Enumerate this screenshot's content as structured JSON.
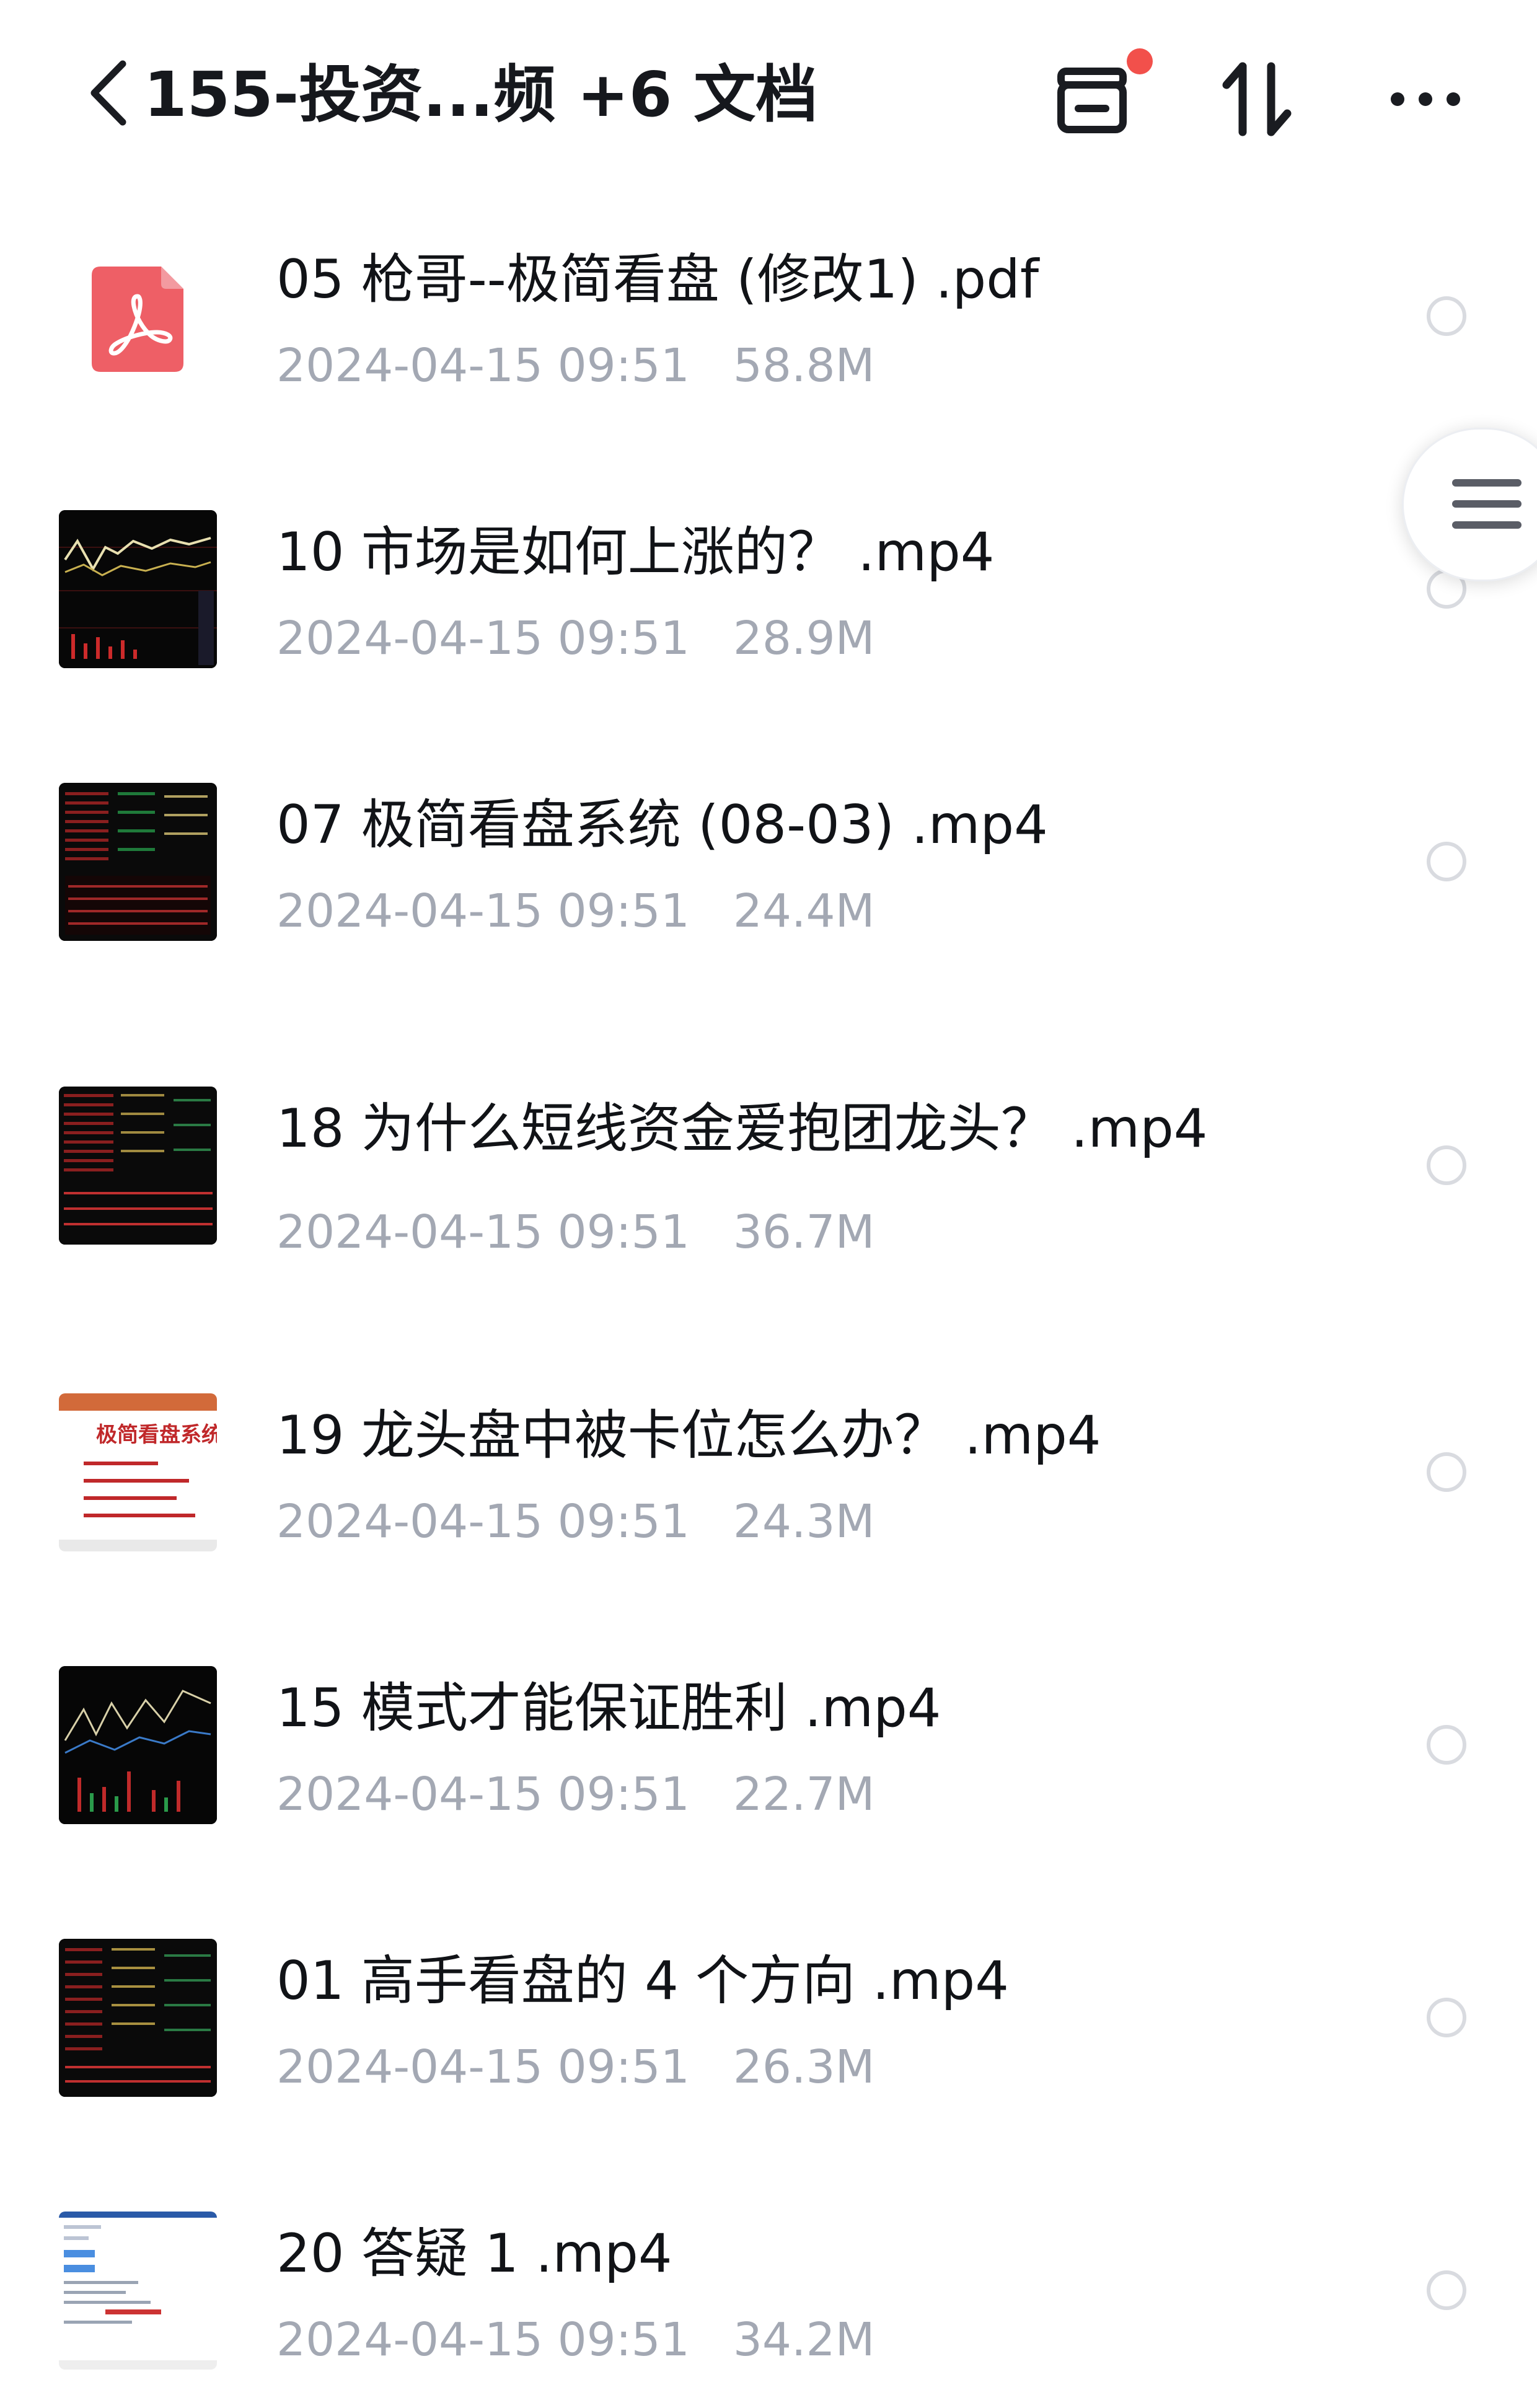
{
  "header": {
    "title": "155-投资...频 +6 文档",
    "icons": [
      "back-icon",
      "transfer-list-icon",
      "sort-icon",
      "more-icon"
    ],
    "badge_color": "#f2504b"
  },
  "files": [
    {
      "name": "05 枪哥--极简看盘 (修改1) .pdf",
      "date": "2024-04-15 09:51",
      "size": "58.8M",
      "type": "pdf"
    },
    {
      "name": "10 市场是如何上涨的？ .mp4",
      "date": "2024-04-15 09:51",
      "size": "28.9M",
      "type": "video"
    },
    {
      "name": "07 极简看盘系统 (08-03) .mp4",
      "date": "2024-04-15 09:51",
      "size": "24.4M",
      "type": "video"
    },
    {
      "name": "18 为什么短线资金爱抱团龙头？ .mp4",
      "date": "2024-04-15 09:51",
      "size": "36.7M",
      "type": "video"
    },
    {
      "name": "19 龙头盘中被卡位怎么办？ .mp4",
      "date": "2024-04-15 09:51",
      "size": "24.3M",
      "type": "video"
    },
    {
      "name": "15 模式才能保证胜利 .mp4",
      "date": "2024-04-15 09:51",
      "size": "22.7M",
      "type": "video"
    },
    {
      "name": "01 高手看盘的 4 个方向 .mp4",
      "date": "2024-04-15 09:51",
      "size": "26.3M",
      "type": "video"
    },
    {
      "name": "20 答疑 1 .mp4",
      "date": "2024-04-15 09:51",
      "size": "34.2M",
      "type": "video"
    }
  ],
  "thumbnail_texts": {
    "slide_title": "极简看盘系统"
  },
  "colors": {
    "pdf_red": "#ee5f66",
    "meta_gray": "#a3a8b3",
    "radio_border": "#d9dbe0"
  }
}
